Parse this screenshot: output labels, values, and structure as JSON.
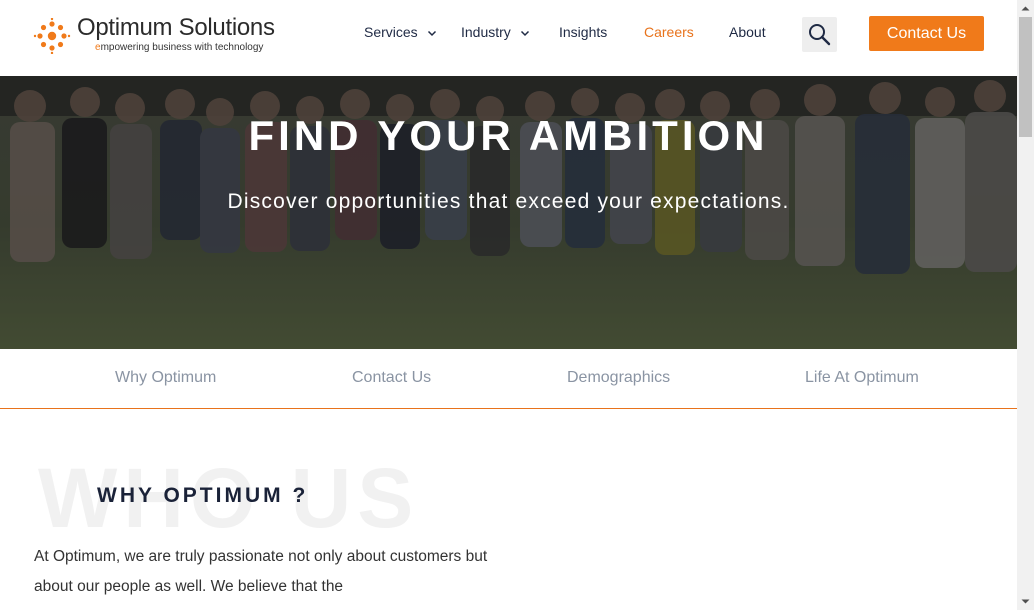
{
  "header": {
    "logo_name": "Optimum Solutions",
    "logo_tag_first": "e",
    "logo_tag_rest": "mpowering business with technology",
    "nav": {
      "services": "Services",
      "industry": "Industry",
      "insights": "Insights",
      "careers": "Careers",
      "about": "About"
    },
    "contact_button": "Contact Us"
  },
  "hero": {
    "title": "FIND YOUR AMBITION",
    "subtitle": "Discover opportunities that exceed your expectations."
  },
  "subnav": {
    "why": "Why Optimum",
    "contact": "Contact Us",
    "demographics": "Demographics",
    "life": "Life At Optimum"
  },
  "section": {
    "watermark": "WHO US",
    "title": "WHY OPTIMUM ?",
    "text": "At Optimum, we are truly passionate not only about customers but about our people as well. We believe that the"
  },
  "colors": {
    "accent": "#f07a1a",
    "nav_text": "#1f2a44",
    "subnav_text": "#8a94a3"
  },
  "icons": {
    "search": "search-icon",
    "chevron": "chevron-down-icon",
    "logo": "logo-mark-icon"
  }
}
